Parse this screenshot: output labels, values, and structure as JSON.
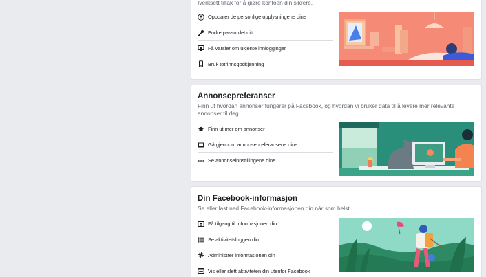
{
  "colors": {
    "page_bg": "#e9ebee",
    "card_bg": "#ffffff",
    "security_illustration": "#f37e6b",
    "ads_illustration": "#2a8f7a",
    "fbinfo_illustration": "#8fd9c7"
  },
  "security": {
    "description": "Iverksett tiltak for å gjøre kontoen din sikrere.",
    "items": [
      {
        "label": "Oppdater de personlige opplysningene dine",
        "icon": "user-circle-icon"
      },
      {
        "label": "Endre passordet ditt",
        "icon": "key-icon"
      },
      {
        "label": "Få varsler om ukjente innlogginger",
        "icon": "device-alert-icon"
      },
      {
        "label": "Bruk totrinnsgodkjenning",
        "icon": "phone-icon"
      }
    ]
  },
  "ads": {
    "title": "Annonsepreferanser",
    "description": "Finn ut hvordan annonser fungerer på Facebook, og hvordan vi bruker data til å levere mer relevante annonser til deg.",
    "items": [
      {
        "label": "Finn ut mer om annonser",
        "icon": "graduation-cap-icon"
      },
      {
        "label": "Gå gjennom annonsepreferansene dine",
        "icon": "laptop-icon"
      },
      {
        "label": "Se annonseinnstillingene dine",
        "icon": "more-dots-icon"
      }
    ]
  },
  "fbinfo": {
    "title": "Din Facebook-informasjon",
    "description": "Se eller last ned Facebook-informasjonen din når som helst.",
    "items": [
      {
        "label": "Få tilgang til informasjonen din",
        "icon": "id-card-icon"
      },
      {
        "label": "Se aktivitetsloggen din",
        "icon": "list-icon"
      },
      {
        "label": "Administrer informasjonen din",
        "icon": "gear-icon"
      },
      {
        "label": "Vis eller slett aktiviteten din utenfor Facebook",
        "icon": "history-icon"
      }
    ]
  }
}
